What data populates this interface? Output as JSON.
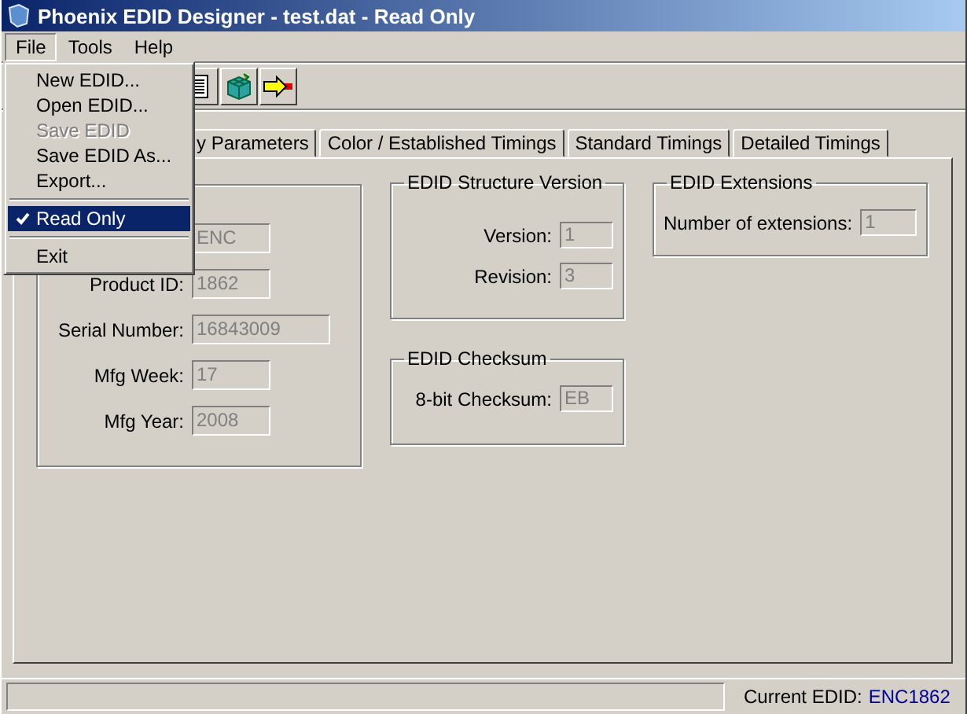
{
  "window": {
    "title": "Phoenix EDID Designer - test.dat - Read Only"
  },
  "menu_bar": [
    {
      "label": "File",
      "selected": true
    },
    {
      "label": "Tools",
      "selected": false
    },
    {
      "label": "Help",
      "selected": false
    }
  ],
  "file_menu": [
    {
      "kind": "item",
      "label": "New EDID...",
      "disabled": false,
      "checked": false,
      "selected": false
    },
    {
      "kind": "item",
      "label": "Open EDID...",
      "disabled": false,
      "checked": false,
      "selected": false
    },
    {
      "kind": "item",
      "label": "Save EDID",
      "disabled": true,
      "checked": false,
      "selected": false
    },
    {
      "kind": "item",
      "label": "Save EDID As...",
      "disabled": false,
      "checked": false,
      "selected": false
    },
    {
      "kind": "item",
      "label": "Export...",
      "disabled": false,
      "checked": false,
      "selected": false
    },
    {
      "kind": "separator"
    },
    {
      "kind": "item",
      "label": "Read Only",
      "disabled": false,
      "checked": true,
      "selected": true
    },
    {
      "kind": "separator"
    },
    {
      "kind": "item",
      "label": "Exit",
      "disabled": false,
      "checked": false,
      "selected": false
    }
  ],
  "tabs": [
    {
      "label": "y Parameters",
      "selected": false
    },
    {
      "label": "Color /  Established Timings",
      "selected": false
    },
    {
      "label": "Standard Timings",
      "selected": false
    },
    {
      "label": "Detailed Timings",
      "selected": false
    }
  ],
  "groups": [
    {
      "fields": [
        {
          "value": "ENC",
          "disabled": true
        },
        {
          "label": "Product ID:",
          "value": "1862",
          "disabled": true
        },
        {
          "label": "Serial Number:",
          "value": "16843009",
          "disabled": true
        },
        {
          "label": "Mfg Week:",
          "value": "17",
          "disabled": true
        },
        {
          "label": "Mfg Year:",
          "value": "2008",
          "disabled": true
        }
      ]
    },
    {
      "title": "EDID Structure Version",
      "fields": [
        {
          "label": "Version:",
          "value": "1",
          "disabled": true
        },
        {
          "label": "Revision:",
          "value": "3",
          "disabled": true
        }
      ]
    },
    {
      "title": "EDID Checksum",
      "fields": [
        {
          "label": "8-bit Checksum:",
          "value": "EB",
          "disabled": true
        }
      ]
    },
    {
      "title": "EDID Extensions",
      "fields": [
        {
          "label": "Number of extensions:",
          "value": "1",
          "disabled": true
        }
      ]
    }
  ],
  "status_bar": {
    "label": "Current EDID:",
    "value": "ENC1862"
  }
}
